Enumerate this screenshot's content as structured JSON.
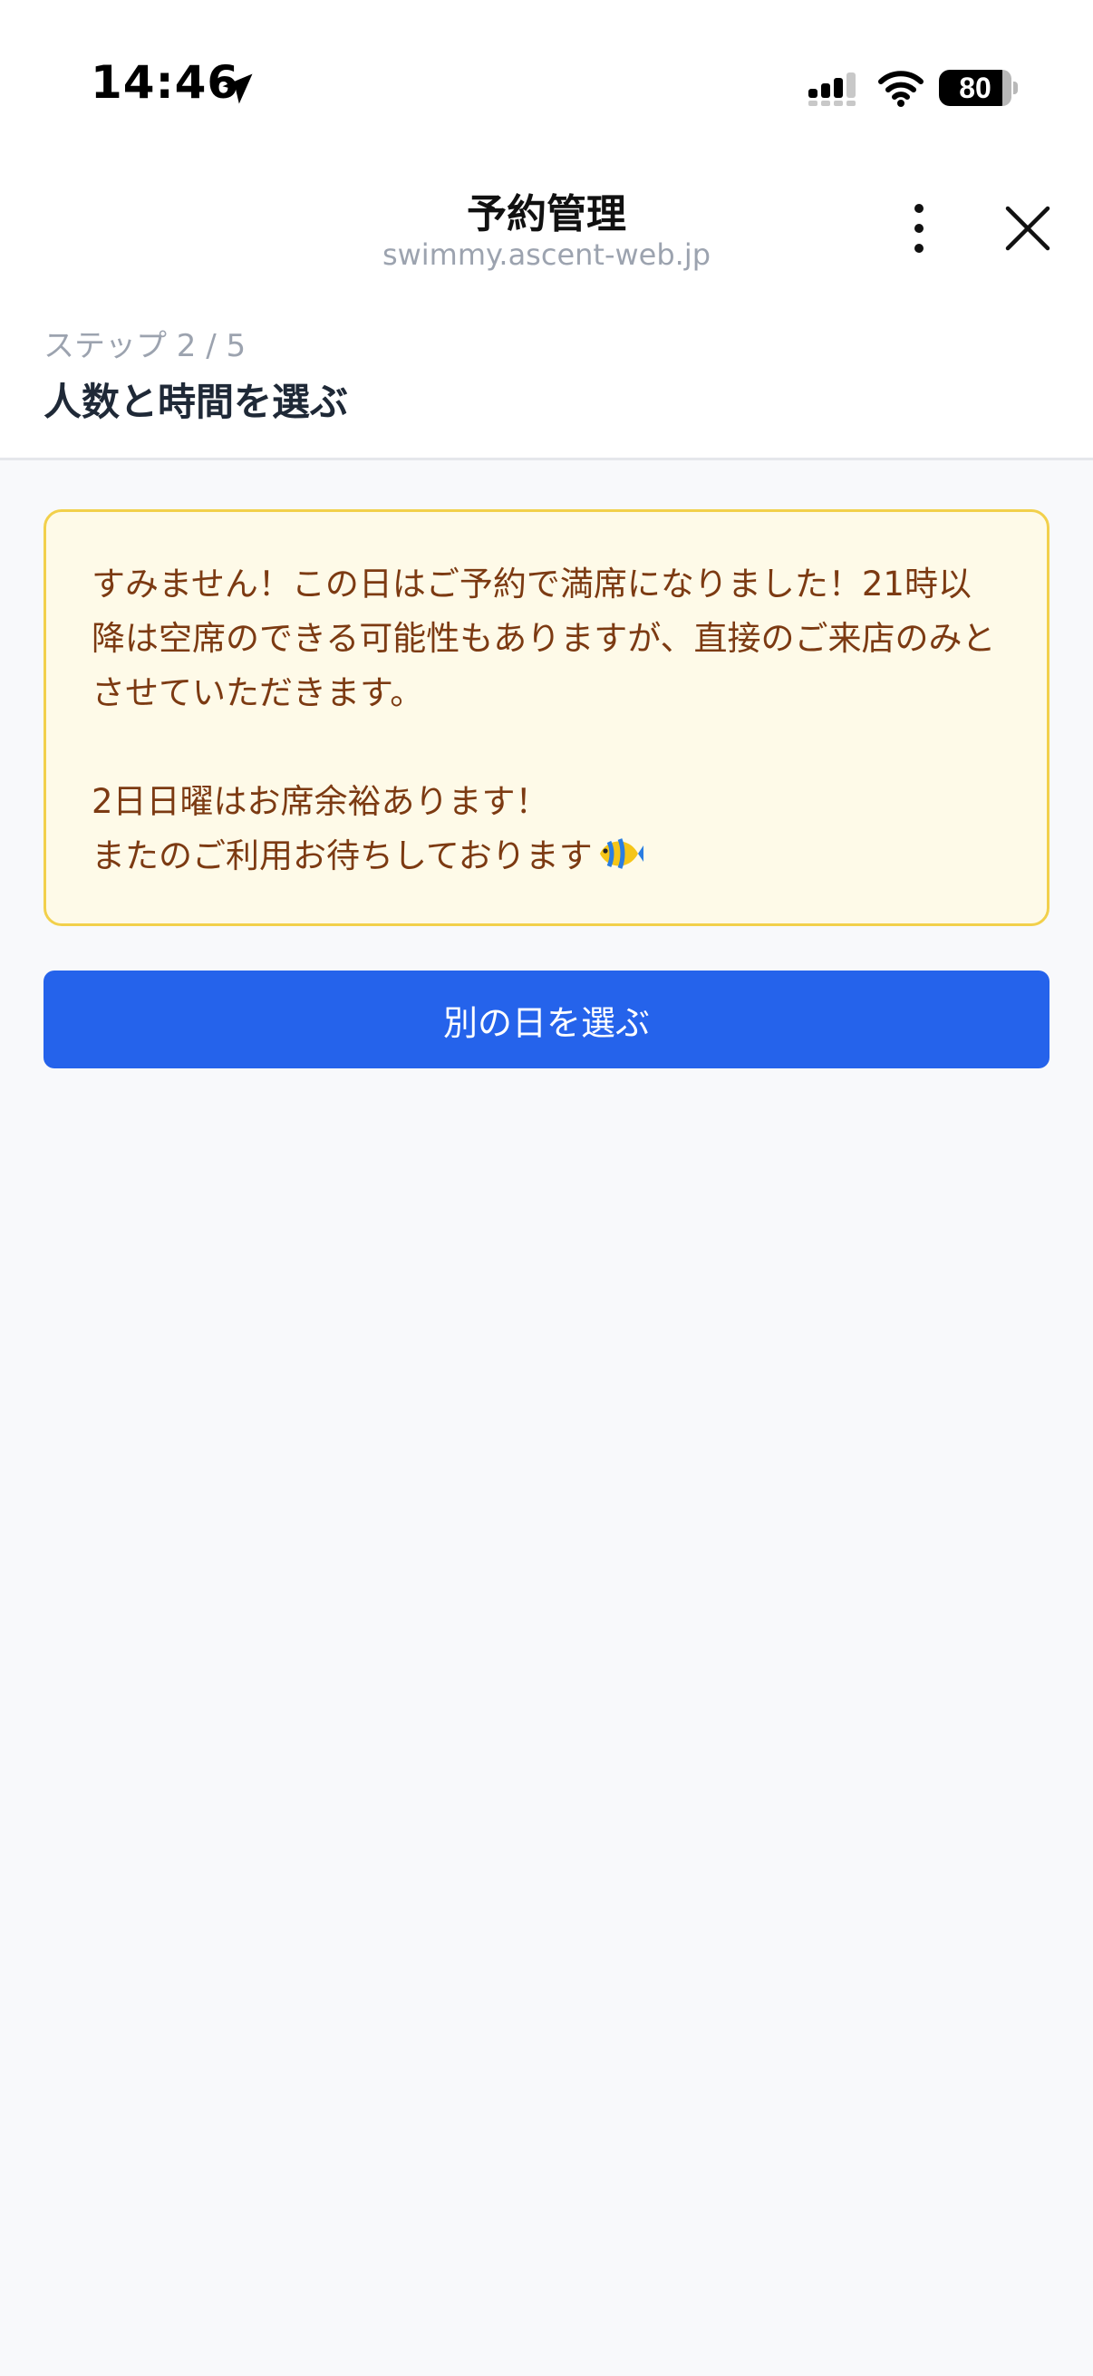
{
  "status_bar": {
    "time": "14:46",
    "battery": "80"
  },
  "header": {
    "title": "予約管理",
    "domain": "swimmy.ascent-web.jp"
  },
  "step": {
    "label": "ステップ 2 / 5",
    "title": "人数と時間を選ぶ"
  },
  "notice": {
    "message": "すみません！この日はご予約で満席になりました！21時以降は空席のできる可能性もありますが、直接のご来店のみとさせていただきます。\n\n2日日曜はお席余裕あります！\nまたのご利用お待ちしております",
    "emoji_icon": "tropical-fish-icon"
  },
  "actions": {
    "choose_other_day": "別の日を選ぶ"
  },
  "colors": {
    "primary": "#2563eb",
    "notice_bg": "#fefae8",
    "notice_border": "#f2d04b",
    "notice_text": "#7c3a12"
  }
}
